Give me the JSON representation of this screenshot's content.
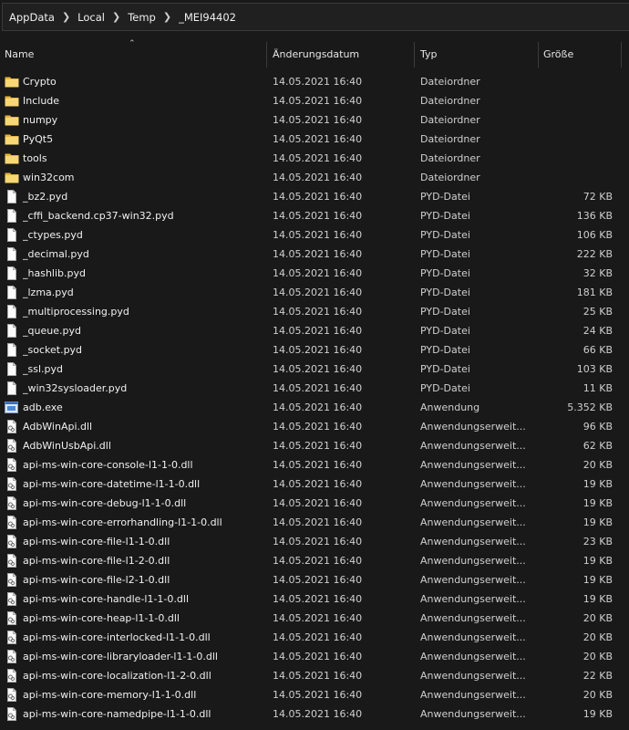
{
  "breadcrumb": [
    "AppData",
    "Local",
    "Temp",
    "_MEI94402"
  ],
  "columns": {
    "name": "Name",
    "date": "Änderungsdatum",
    "type": "Typ",
    "size": "Größe"
  },
  "files": [
    {
      "name": "Crypto",
      "date": "14.05.2021 16:40",
      "type": "Dateiordner",
      "size": "",
      "icon": "folder-icon"
    },
    {
      "name": "Include",
      "date": "14.05.2021 16:40",
      "type": "Dateiordner",
      "size": "",
      "icon": "folder-icon"
    },
    {
      "name": "numpy",
      "date": "14.05.2021 16:40",
      "type": "Dateiordner",
      "size": "",
      "icon": "folder-icon"
    },
    {
      "name": "PyQt5",
      "date": "14.05.2021 16:40",
      "type": "Dateiordner",
      "size": "",
      "icon": "folder-icon"
    },
    {
      "name": "tools",
      "date": "14.05.2021 16:40",
      "type": "Dateiordner",
      "size": "",
      "icon": "folder-icon"
    },
    {
      "name": "win32com",
      "date": "14.05.2021 16:40",
      "type": "Dateiordner",
      "size": "",
      "icon": "folder-icon"
    },
    {
      "name": "_bz2.pyd",
      "date": "14.05.2021 16:40",
      "type": "PYD-Datei",
      "size": "72 KB",
      "icon": "file-icon"
    },
    {
      "name": "_cffi_backend.cp37-win32.pyd",
      "date": "14.05.2021 16:40",
      "type": "PYD-Datei",
      "size": "136 KB",
      "icon": "file-icon"
    },
    {
      "name": "_ctypes.pyd",
      "date": "14.05.2021 16:40",
      "type": "PYD-Datei",
      "size": "106 KB",
      "icon": "file-icon"
    },
    {
      "name": "_decimal.pyd",
      "date": "14.05.2021 16:40",
      "type": "PYD-Datei",
      "size": "222 KB",
      "icon": "file-icon"
    },
    {
      "name": "_hashlib.pyd",
      "date": "14.05.2021 16:40",
      "type": "PYD-Datei",
      "size": "32 KB",
      "icon": "file-icon"
    },
    {
      "name": "_lzma.pyd",
      "date": "14.05.2021 16:40",
      "type": "PYD-Datei",
      "size": "181 KB",
      "icon": "file-icon"
    },
    {
      "name": "_multiprocessing.pyd",
      "date": "14.05.2021 16:40",
      "type": "PYD-Datei",
      "size": "25 KB",
      "icon": "file-icon"
    },
    {
      "name": "_queue.pyd",
      "date": "14.05.2021 16:40",
      "type": "PYD-Datei",
      "size": "24 KB",
      "icon": "file-icon"
    },
    {
      "name": "_socket.pyd",
      "date": "14.05.2021 16:40",
      "type": "PYD-Datei",
      "size": "66 KB",
      "icon": "file-icon"
    },
    {
      "name": "_ssl.pyd",
      "date": "14.05.2021 16:40",
      "type": "PYD-Datei",
      "size": "103 KB",
      "icon": "file-icon"
    },
    {
      "name": "_win32sysloader.pyd",
      "date": "14.05.2021 16:40",
      "type": "PYD-Datei",
      "size": "11 KB",
      "icon": "file-icon"
    },
    {
      "name": "adb.exe",
      "date": "14.05.2021 16:40",
      "type": "Anwendung",
      "size": "5.352 KB",
      "icon": "exe-icon"
    },
    {
      "name": "AdbWinApi.dll",
      "date": "14.05.2021 16:40",
      "type": "Anwendungserweit...",
      "size": "96 KB",
      "icon": "dll-icon"
    },
    {
      "name": "AdbWinUsbApi.dll",
      "date": "14.05.2021 16:40",
      "type": "Anwendungserweit...",
      "size": "62 KB",
      "icon": "dll-icon"
    },
    {
      "name": "api-ms-win-core-console-l1-1-0.dll",
      "date": "14.05.2021 16:40",
      "type": "Anwendungserweit...",
      "size": "20 KB",
      "icon": "dll-icon"
    },
    {
      "name": "api-ms-win-core-datetime-l1-1-0.dll",
      "date": "14.05.2021 16:40",
      "type": "Anwendungserweit...",
      "size": "19 KB",
      "icon": "dll-icon"
    },
    {
      "name": "api-ms-win-core-debug-l1-1-0.dll",
      "date": "14.05.2021 16:40",
      "type": "Anwendungserweit...",
      "size": "19 KB",
      "icon": "dll-icon"
    },
    {
      "name": "api-ms-win-core-errorhandling-l1-1-0.dll",
      "date": "14.05.2021 16:40",
      "type": "Anwendungserweit...",
      "size": "19 KB",
      "icon": "dll-icon"
    },
    {
      "name": "api-ms-win-core-file-l1-1-0.dll",
      "date": "14.05.2021 16:40",
      "type": "Anwendungserweit...",
      "size": "23 KB",
      "icon": "dll-icon"
    },
    {
      "name": "api-ms-win-core-file-l1-2-0.dll",
      "date": "14.05.2021 16:40",
      "type": "Anwendungserweit...",
      "size": "19 KB",
      "icon": "dll-icon"
    },
    {
      "name": "api-ms-win-core-file-l2-1-0.dll",
      "date": "14.05.2021 16:40",
      "type": "Anwendungserweit...",
      "size": "19 KB",
      "icon": "dll-icon"
    },
    {
      "name": "api-ms-win-core-handle-l1-1-0.dll",
      "date": "14.05.2021 16:40",
      "type": "Anwendungserweit...",
      "size": "19 KB",
      "icon": "dll-icon"
    },
    {
      "name": "api-ms-win-core-heap-l1-1-0.dll",
      "date": "14.05.2021 16:40",
      "type": "Anwendungserweit...",
      "size": "20 KB",
      "icon": "dll-icon"
    },
    {
      "name": "api-ms-win-core-interlocked-l1-1-0.dll",
      "date": "14.05.2021 16:40",
      "type": "Anwendungserweit...",
      "size": "20 KB",
      "icon": "dll-icon"
    },
    {
      "name": "api-ms-win-core-libraryloader-l1-1-0.dll",
      "date": "14.05.2021 16:40",
      "type": "Anwendungserweit...",
      "size": "20 KB",
      "icon": "dll-icon"
    },
    {
      "name": "api-ms-win-core-localization-l1-2-0.dll",
      "date": "14.05.2021 16:40",
      "type": "Anwendungserweit...",
      "size": "22 KB",
      "icon": "dll-icon"
    },
    {
      "name": "api-ms-win-core-memory-l1-1-0.dll",
      "date": "14.05.2021 16:40",
      "type": "Anwendungserweit...",
      "size": "20 KB",
      "icon": "dll-icon"
    },
    {
      "name": "api-ms-win-core-namedpipe-l1-1-0.dll",
      "date": "14.05.2021 16:40",
      "type": "Anwendungserweit...",
      "size": "19 KB",
      "icon": "dll-icon"
    }
  ]
}
